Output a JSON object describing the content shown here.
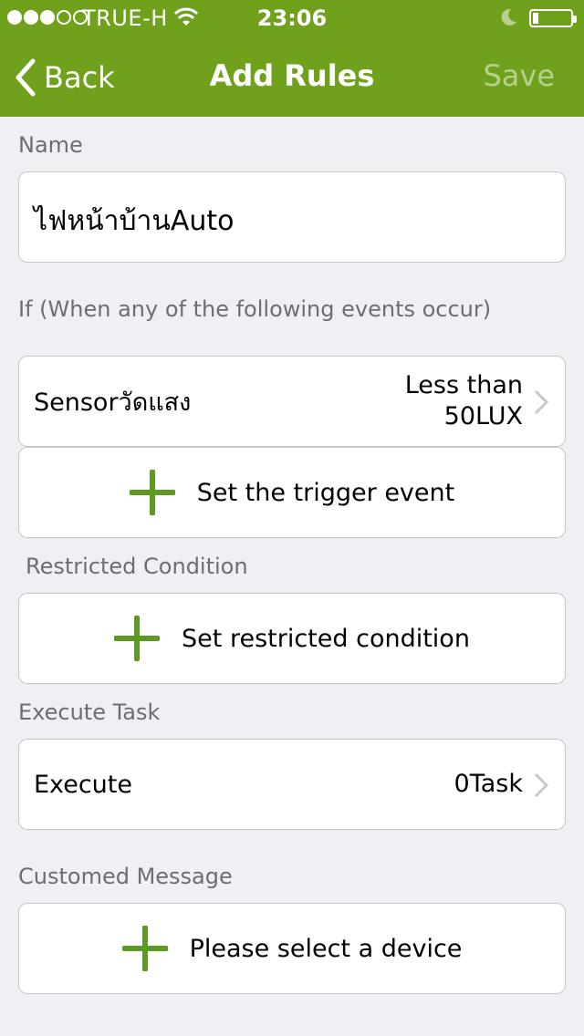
{
  "status": {
    "carrier": "TRUE-H",
    "time": "23:06"
  },
  "nav": {
    "back_label": "Back",
    "title": "Add Rules",
    "save_label": "Save"
  },
  "name_section": {
    "label": "Name",
    "value": "ไฟหน้าบ้านAuto"
  },
  "if_section": {
    "label": "If (When any of the following events occur)",
    "event": {
      "name": "Sensorวัดแสง",
      "condition_line1": "Less than",
      "condition_line2": "50LUX"
    },
    "add_label": "Set the trigger event"
  },
  "restricted_section": {
    "label": "Restricted Condition",
    "add_label": "Set restricted condition"
  },
  "execute_section": {
    "label": "Execute Task",
    "row_label": "Execute",
    "row_value": "0Task"
  },
  "message_section": {
    "label": "Customed Message",
    "add_label": "Please select a device"
  },
  "colors": {
    "accent": "#6fa11c",
    "save_disabled": "#b8d08d",
    "plus_icon": "#5e9a23"
  }
}
